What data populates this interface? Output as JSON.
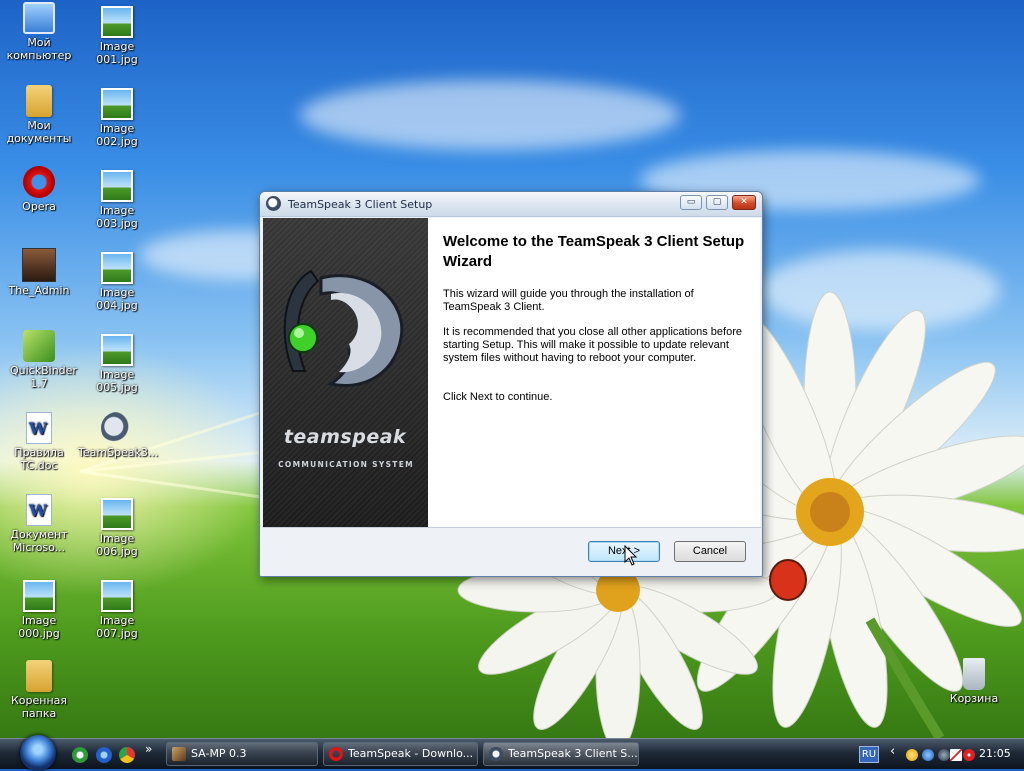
{
  "desktop": {
    "icons": [
      {
        "label": "Мой компьютер",
        "icon": "my-computer-icon"
      },
      {
        "label": "Image 001.jpg",
        "icon": "image-file-icon"
      },
      {
        "label": "Мои документы",
        "icon": "my-documents-folder-icon"
      },
      {
        "label": "Image 002.jpg",
        "icon": "image-file-icon"
      },
      {
        "label": "Opera",
        "icon": "opera-icon"
      },
      {
        "label": "Image 003.jpg",
        "icon": "image-file-icon"
      },
      {
        "label": "The_Admin",
        "icon": "user-avatar-icon"
      },
      {
        "label": "Image 004.jpg",
        "icon": "image-file-icon"
      },
      {
        "label": "QuickBinder 1.7",
        "icon": "quickbinder-icon"
      },
      {
        "label": "Image 005.jpg",
        "icon": "image-file-icon"
      },
      {
        "label": "Правила TC.doc",
        "icon": "word-document-icon"
      },
      {
        "label": "TeamSpeak3...",
        "icon": "teamspeak-icon"
      },
      {
        "label": "Документ Microso...",
        "icon": "word-document-icon"
      },
      {
        "label": "Image 006.jpg",
        "icon": "image-file-icon"
      },
      {
        "label": "Image 000.jpg",
        "icon": "image-file-icon"
      },
      {
        "label": "Image 007.jpg",
        "icon": "image-file-icon"
      },
      {
        "label": "Коренная папка",
        "icon": "folder-icon"
      },
      {
        "label": "Корзина",
        "icon": "recycle-bin-icon"
      }
    ]
  },
  "window": {
    "title": "TeamSpeak 3 Client Setup",
    "controls": {
      "minimize": "▭",
      "maximize": "▢",
      "close": "✕"
    },
    "side_panel": {
      "brand": "teamspeak",
      "tagline": "COMMUNICATION SYSTEM"
    },
    "heading": "Welcome to the TeamSpeak 3 Client Setup Wizard",
    "paragraph1": "This wizard will guide you through the installation of TeamSpeak 3 Client.",
    "paragraph2": "It is recommended that you close all other applications before starting Setup. This will make it possible to update relevant system files without having to reboot your computer.",
    "paragraph3": "Click Next to continue.",
    "next_label": "Next >",
    "cancel_label": "Cancel"
  },
  "taskbar": {
    "tasks": [
      {
        "label": "SA-MP 0.3",
        "icon": "samp-icon"
      },
      {
        "label": "TeamSpeak - Downlo...",
        "icon": "opera-icon"
      },
      {
        "label": "TeamSpeak 3 Client S...",
        "icon": "teamspeak-icon"
      }
    ],
    "quicklaunch_more": "»",
    "language": "RU",
    "tray_expand": "‹",
    "clock": "21:05"
  },
  "colors": {
    "accent": "#3c7fb1",
    "close_button": "#d24a2a",
    "side_panel": "#2a2a2a",
    "logo_green": "#3fd12a"
  }
}
